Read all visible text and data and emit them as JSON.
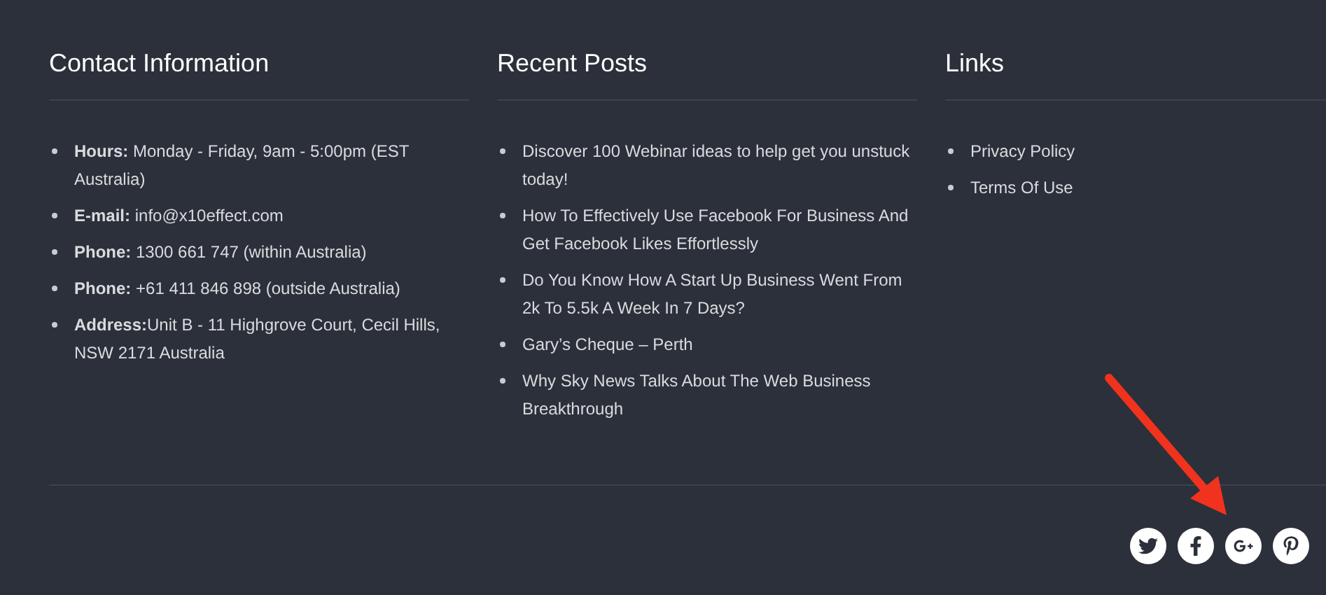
{
  "columns": [
    {
      "title": "Contact Information",
      "kind": "contact",
      "items": [
        "**Hours:** Monday - Friday, 9am - 5:00pm (EST Australia)",
        "**E-mail:** info@x10effect.com",
        "**Phone:** 1300 661 747 (within Australia)",
        "**Phone:** +61 411 846 898 (outside Australia)",
        "**Address:**Unit B - 11 Highgrove Court, Cecil Hills, NSW 2171 Australia"
      ]
    },
    {
      "title": "Recent Posts",
      "kind": "links",
      "items": [
        "Discover 100 Webinar ideas to help get you unstuck today!",
        "How To Effectively Use Facebook For Business And Get Facebook Likes Effortlessly",
        "Do You Know How A Start Up Business Went From 2k To 5.5k A Week In 7 Days?",
        "Gary’s Cheque – Perth",
        "Why Sky News Talks About The Web Business Breakthrough"
      ]
    },
    {
      "title": "Links",
      "kind": "links",
      "items": [
        "Privacy Policy",
        "Terms Of Use"
      ]
    }
  ],
  "social": [
    {
      "kind": "twitter"
    },
    {
      "kind": "facebook"
    },
    {
      "kind": "googleplus"
    },
    {
      "kind": "pinterest"
    }
  ],
  "annotation": {
    "kind": "arrow"
  }
}
